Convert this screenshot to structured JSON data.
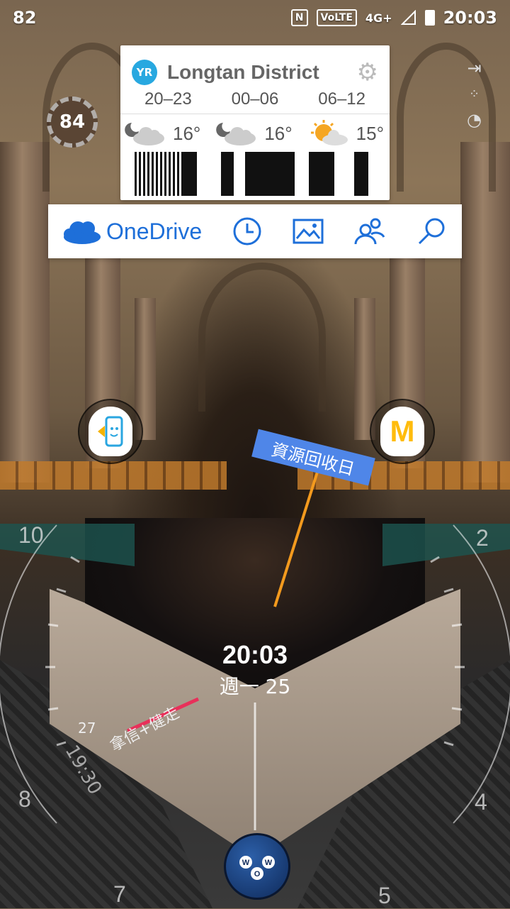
{
  "status_bar": {
    "left_number": "82",
    "nfc": "N",
    "volte": "VoLTE",
    "network": "4G+",
    "time": "20:03"
  },
  "weather": {
    "logo": "YR",
    "city": "Longtan District",
    "periods": [
      {
        "time": "20–23",
        "temp": "16°",
        "icon": "cloud-moon-icon"
      },
      {
        "time": "00–06",
        "temp": "16°",
        "icon": "cloud-moon-icon"
      },
      {
        "time": "06–12",
        "temp": "15°",
        "icon": "sun-cloud-icon"
      }
    ]
  },
  "onedrive": {
    "label": "OneDrive",
    "buttons": [
      "recent-icon",
      "photos-icon",
      "shared-icon",
      "search-icon"
    ]
  },
  "temperature_badge": "84",
  "clock": {
    "time": "20:03",
    "date": "週一 25",
    "hour_labels": {
      "h10": "10",
      "h2": "2",
      "h8": "8",
      "h4": "4",
      "h7": "7",
      "h5": "5"
    },
    "event_main": "資源回收日",
    "event_secondary": "拿信+健走",
    "event_secondary_time": "19:30",
    "event_secondary_day": "27"
  },
  "colors": {
    "onedrive_blue": "#1e6fd9",
    "event_blue": "#4f86e8",
    "yr_blue": "#28a8e0"
  }
}
